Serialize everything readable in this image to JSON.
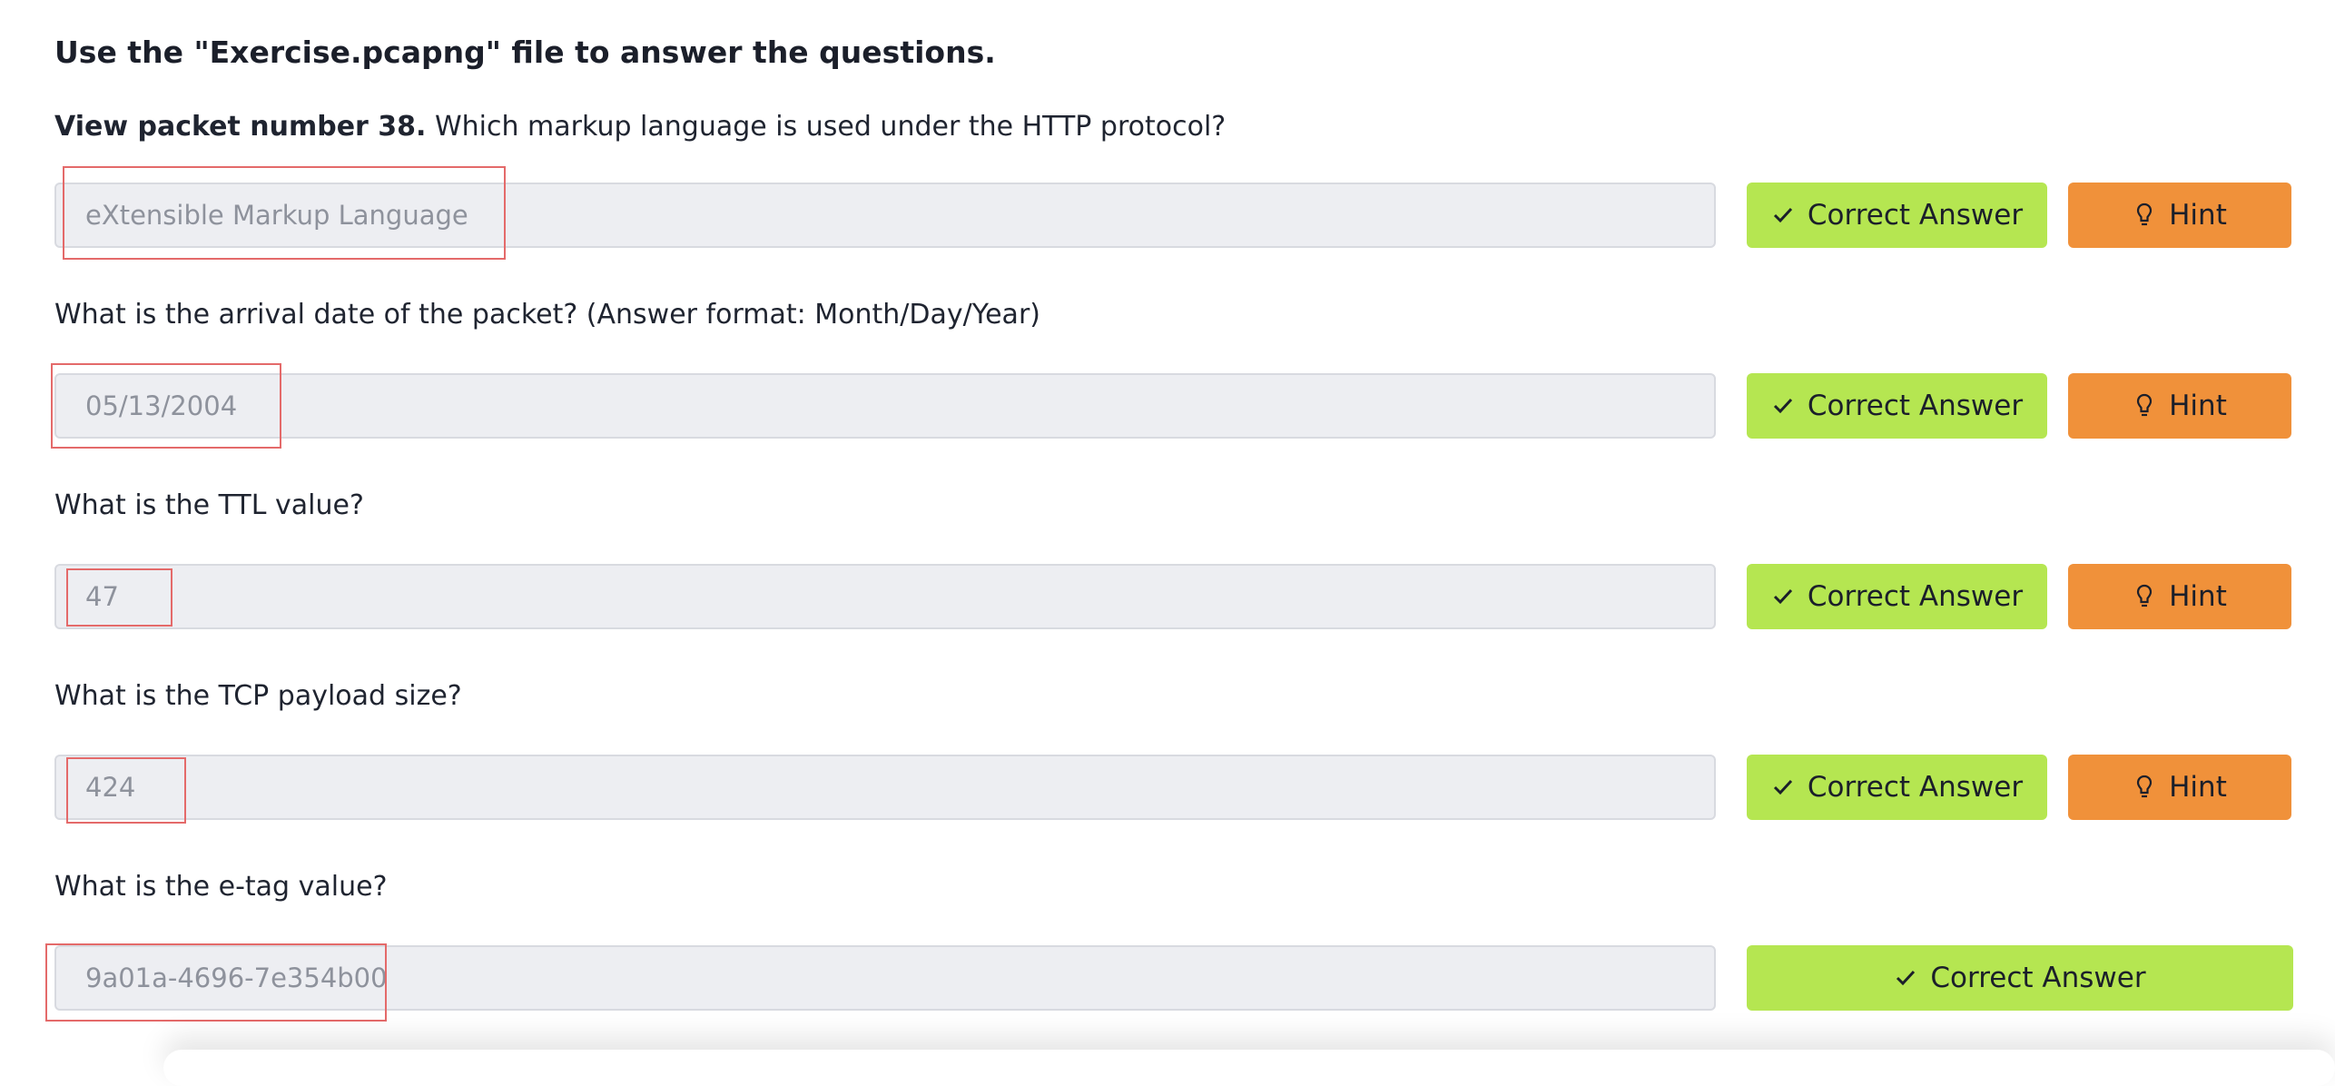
{
  "heading": "Use the \"Exercise.pcapng\" file to answer the questions.",
  "questions": [
    {
      "prefix_bold": "View packet number 38.",
      "text": "Which markup language is used under the HTTP protocol?",
      "answer": "eXtensible Markup Language",
      "correct_label": "Correct Answer",
      "hint_label": "Hint"
    },
    {
      "prefix_bold": "",
      "text": "What is the arrival date of the packet? (Answer format: Month/Day/Year)",
      "answer": "05/13/2004",
      "correct_label": "Correct Answer",
      "hint_label": "Hint"
    },
    {
      "prefix_bold": "",
      "text": "What is the TTL value?",
      "answer": "47",
      "correct_label": "Correct Answer",
      "hint_label": "Hint"
    },
    {
      "prefix_bold": "",
      "text": "What is the TCP payload size?",
      "answer": "424",
      "correct_label": "Correct Answer",
      "hint_label": "Hint"
    },
    {
      "prefix_bold": "",
      "text": "What is the e-tag value?",
      "answer": "9a01a-4696-7e354b00",
      "correct_label": "Correct Answer"
    }
  ],
  "icons": {
    "correct": "check-icon",
    "hint": "lightbulb-icon"
  },
  "colors": {
    "correct_button": "#b5e651",
    "hint_button": "#f0913a",
    "input_background": "#edeef2",
    "highlight_box": "#e46a6a"
  }
}
